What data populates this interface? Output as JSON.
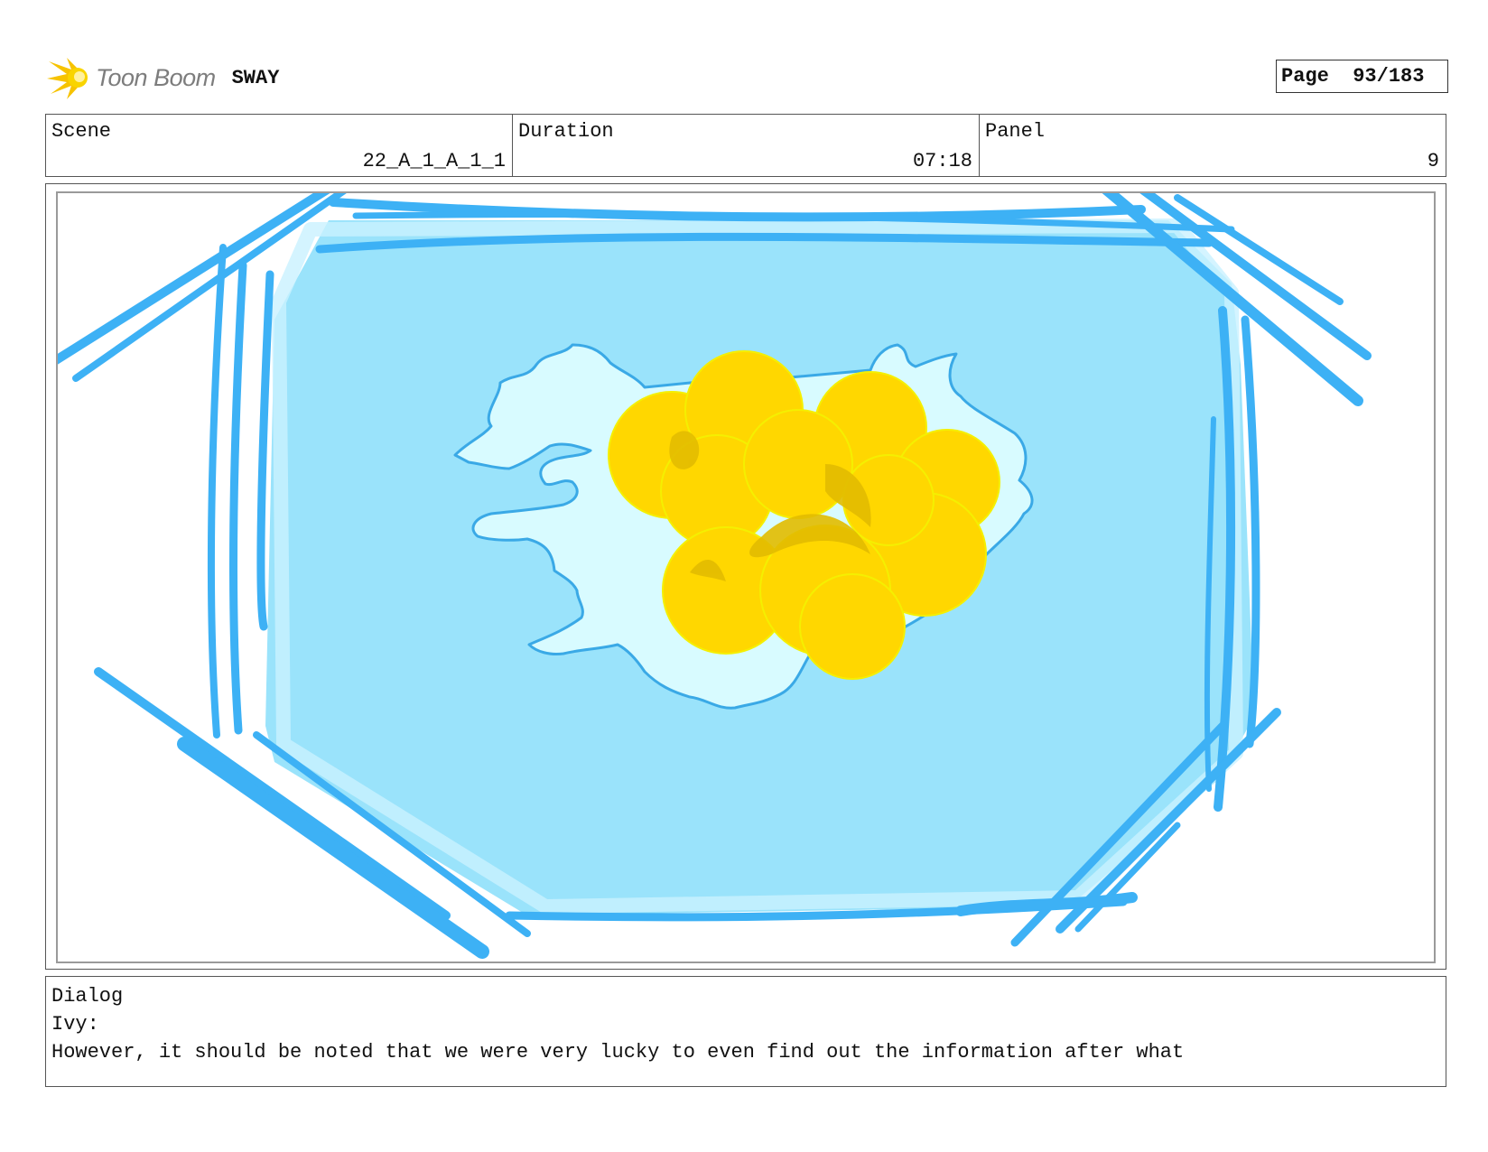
{
  "header": {
    "logo_text": "Toon Boom",
    "project_name": "SWAY",
    "page_label": "Page",
    "page_value": "93/183"
  },
  "info": {
    "scene_label": "Scene",
    "scene_value": "22_A_1_A_1_1",
    "duration_label": "Duration",
    "duration_value": "07:18",
    "panel_label": "Panel",
    "panel_value": "9"
  },
  "artwork": {
    "sea_color": "#9ae3fb",
    "stroke_color": "#3db1f5",
    "land_color": "#d8fbff",
    "explosion_color": "#ffd700",
    "explosion_shadow_color": "#e3bc00"
  },
  "dialog": {
    "label": "Dialog",
    "speaker": "Ivy:",
    "text": "However, it should be noted that we were very lucky to even find out the information after what"
  }
}
